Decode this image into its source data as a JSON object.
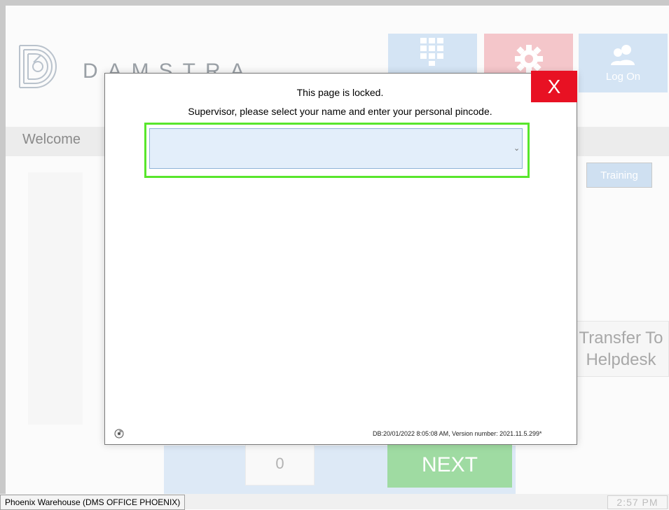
{
  "brand": {
    "name": "DAMSTRA"
  },
  "toolbar": {
    "logon_label": "Log On"
  },
  "welcome": {
    "label": "Welcome"
  },
  "buttons": {
    "training": "Training",
    "transfer_line1": "Transfer To",
    "transfer_line2": "Helpdesk",
    "next": "NEXT",
    "counter_value": "0"
  },
  "modal": {
    "close_label": "X",
    "line1": "This page is locked.",
    "line2": "Supervisor, please select your name and enter your personal pincode.",
    "select_value": "",
    "footer_info": "DB:20/01/2022 8:05:08 AM, Version number: 2021.11.5.299*"
  },
  "status": {
    "location": "Phoenix Warehouse (DMS OFFICE PHOENIX)",
    "time": "2:57 PM"
  },
  "colors": {
    "accent_blue": "#d4e4f4",
    "accent_red": "#f4c6ca",
    "close_red": "#e81123",
    "focus_green": "#58e62c",
    "next_green": "#9fdba2"
  },
  "icons": [
    "damstra-logo-icon",
    "keypad-icon",
    "gear-icon",
    "users-icon",
    "chevron-down-icon",
    "disc-icon",
    "close-icon"
  ]
}
